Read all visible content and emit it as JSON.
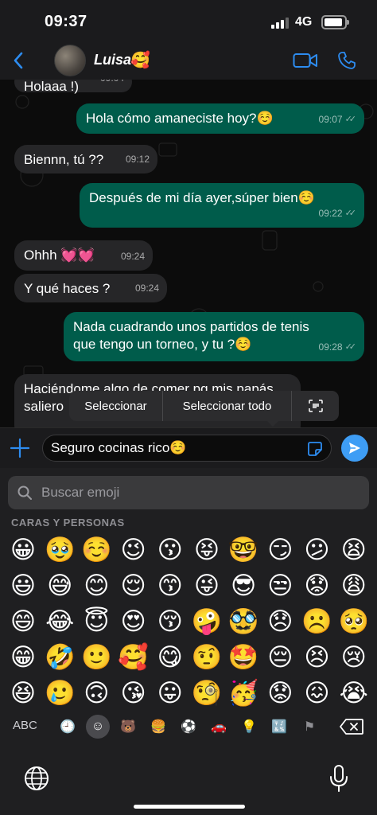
{
  "status_bar": {
    "time": "09:37",
    "network": "4G",
    "battery_level": 0.9,
    "signal_bars": 3
  },
  "header": {
    "contact_name": "Luisa",
    "contact_emoji": "🥰",
    "back_icon": "chevron-left-icon",
    "video_icon": "video-camera-icon",
    "call_icon": "phone-icon",
    "accent_color": "#2d8cf0"
  },
  "messages": [
    {
      "direction": "in",
      "text": "Holaaa !)",
      "time": "09:04",
      "partial": true
    },
    {
      "direction": "out",
      "text": "Hola cómo amaneciste hoy?☺️",
      "time": "09:07",
      "read": true
    },
    {
      "direction": "in",
      "text": "Biennn, tú ??",
      "time": "09:12"
    },
    {
      "direction": "out",
      "text": "Después de mi día ayer,súper bien☺️",
      "time": "09:22",
      "read": true
    },
    {
      "direction": "in",
      "text": "Ohhh 💓💓",
      "time": "09:24"
    },
    {
      "direction": "in",
      "text": "Y qué haces ?",
      "time": "09:24"
    },
    {
      "direction": "out",
      "text": "Nada cuadrando unos partidos de tenis que tengo un torneo, y tu ?☺️",
      "time": "09:28",
      "read": true
    },
    {
      "direction": "in",
      "text": "Haciéndome algo de comer pq mis papás saliero",
      "time": "",
      "partial": true
    }
  ],
  "context_menu": {
    "select": "Seleccionar",
    "select_all": "Seleccionar todo",
    "scan_icon": "scan-text-icon"
  },
  "input_bar": {
    "value": "Seguro cocinas rico☺️",
    "plus_icon": "plus-icon",
    "sticker_icon": "sticker-icon",
    "send_icon": "send-arrow-icon",
    "send_color": "#3e9df5"
  },
  "emoji_keyboard": {
    "search_placeholder": "Buscar emoji",
    "category_label": "CARAS Y PERSONAS",
    "emojis": [
      "😀",
      "🥹",
      "☺️",
      "😉",
      "😗",
      "😝",
      "🤓",
      "😏",
      "😕",
      "😫",
      "😃",
      "😅",
      "😊",
      "😌",
      "😙",
      "😜",
      "😎",
      "😒",
      "😟",
      "😩",
      "😄",
      "😂",
      "😇",
      "😍",
      "😚",
      "🤪",
      "🥸",
      "😞",
      "☹️",
      "🥺",
      "😁",
      "🤣",
      "🙂",
      "🥰",
      "😋",
      "🤨",
      "🤩",
      "😔",
      "😣",
      "😢",
      "😆",
      "🥲",
      "🙃",
      "😘",
      "😛",
      "🧐",
      "🥳",
      "😟",
      "😖",
      "😭"
    ],
    "abc_label": "ABC",
    "category_icons": [
      "🕘",
      "☺",
      "🐻",
      "🍔",
      "⚽",
      "🚗",
      "💡",
      "🔣",
      "⚑"
    ],
    "active_category": 1,
    "delete_icon": "backspace-icon",
    "globe_icon": "globe-icon",
    "mic_icon": "microphone-icon"
  }
}
